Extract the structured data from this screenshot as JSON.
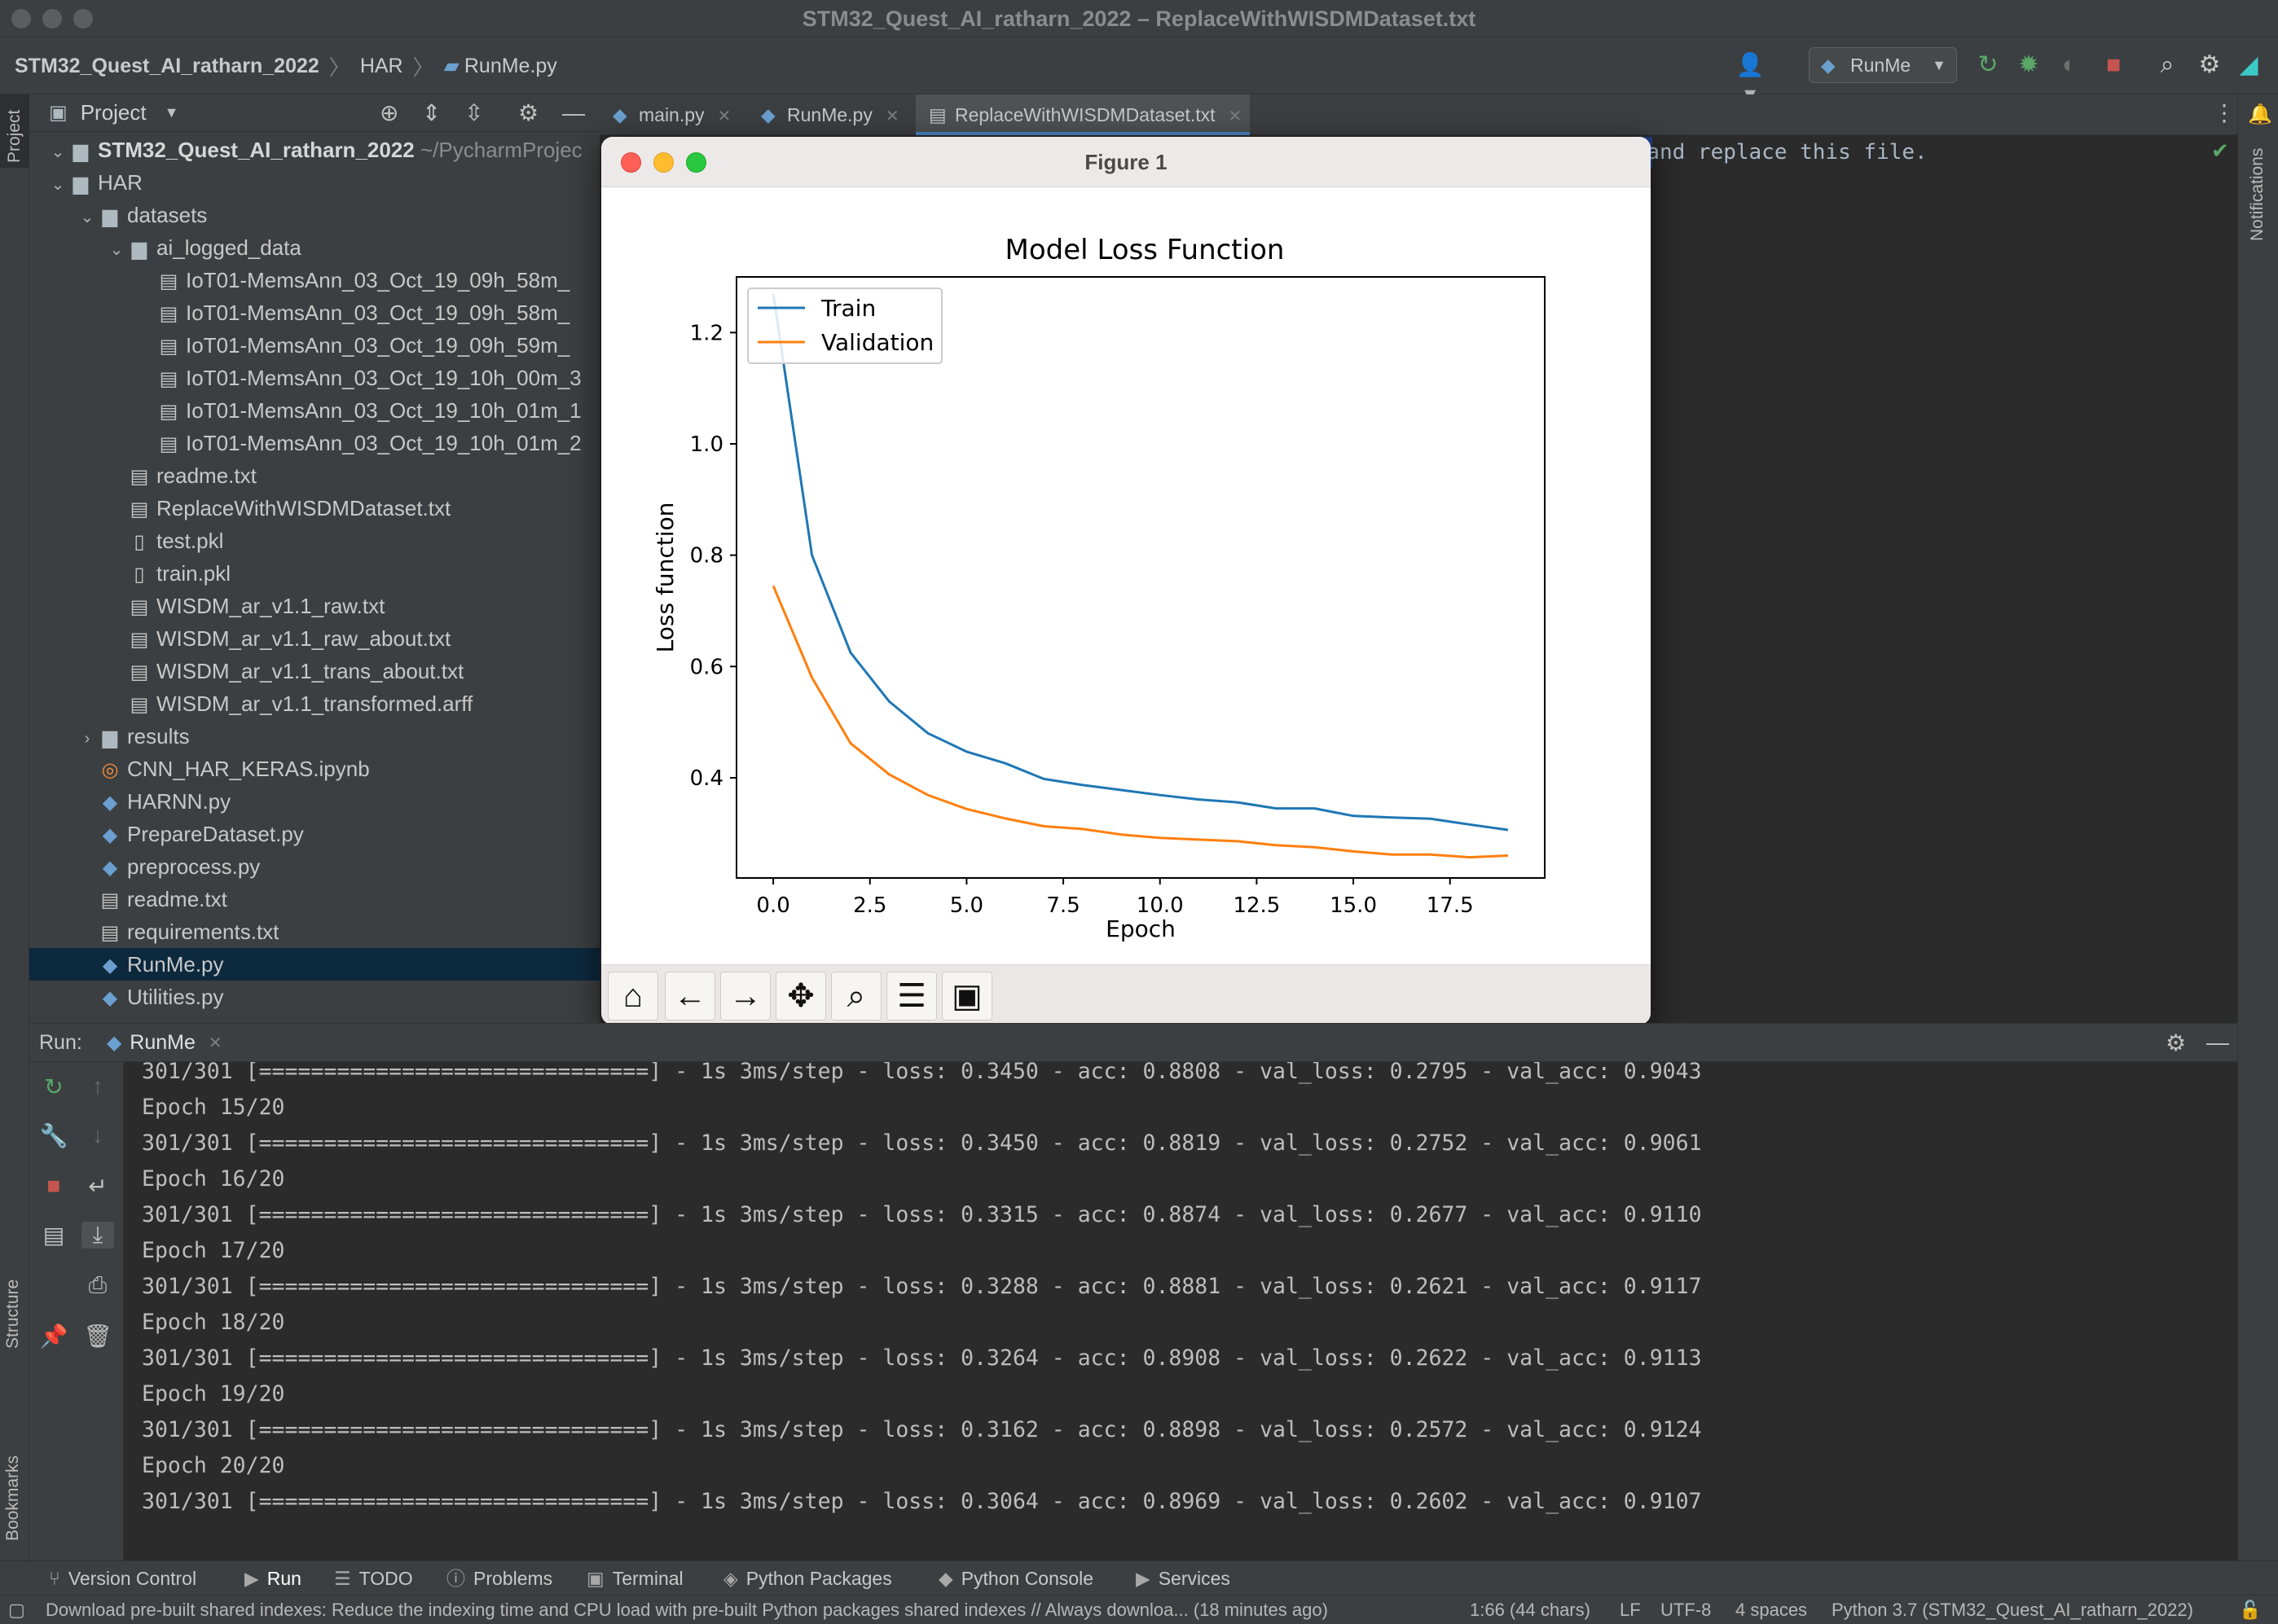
{
  "window": {
    "title": "STM32_Quest_AI_ratharn_2022 – ReplaceWithWISDMDataset.txt"
  },
  "breadcrumb": {
    "project": "STM32_Quest_AI_ratharn_2022",
    "folder": "HAR",
    "file": "RunMe.py"
  },
  "toolbar": {
    "run_config": "RunMe"
  },
  "project_panel": {
    "title": "Project",
    "root": {
      "name": "STM32_Quest_AI_ratharn_2022",
      "path": "~/PycharmProjec"
    },
    "items": [
      {
        "label": "HAR"
      },
      {
        "label": "datasets"
      },
      {
        "label": "ai_logged_data"
      },
      {
        "label": "IoT01-MemsAnn_03_Oct_19_09h_58m_"
      },
      {
        "label": "IoT01-MemsAnn_03_Oct_19_09h_58m_"
      },
      {
        "label": "IoT01-MemsAnn_03_Oct_19_09h_59m_"
      },
      {
        "label": "IoT01-MemsAnn_03_Oct_19_10h_00m_3"
      },
      {
        "label": "IoT01-MemsAnn_03_Oct_19_10h_01m_1"
      },
      {
        "label": "IoT01-MemsAnn_03_Oct_19_10h_01m_2"
      },
      {
        "label": "readme.txt"
      },
      {
        "label": "ReplaceWithWISDMDataset.txt"
      },
      {
        "label": "test.pkl"
      },
      {
        "label": "train.pkl"
      },
      {
        "label": "WISDM_ar_v1.1_raw.txt"
      },
      {
        "label": "WISDM_ar_v1.1_raw_about.txt"
      },
      {
        "label": "WISDM_ar_v1.1_trans_about.txt"
      },
      {
        "label": "WISDM_ar_v1.1_transformed.arff"
      },
      {
        "label": "results"
      },
      {
        "label": "CNN_HAR_KERAS.ipynb"
      },
      {
        "label": "HARNN.py"
      },
      {
        "label": "PrepareDataset.py"
      },
      {
        "label": "preprocess.py"
      },
      {
        "label": "readme.txt"
      },
      {
        "label": "requirements.txt"
      },
      {
        "label": "RunMe.py"
      },
      {
        "label": "Utilities.py"
      }
    ]
  },
  "left_strip": {
    "project": "Project",
    "structure": "Structure",
    "bookmarks": "Bookmarks"
  },
  "right_strip": {
    "notifications": "Notifications"
  },
  "editor": {
    "tabs": [
      {
        "label": "main.py"
      },
      {
        "label": "RunMe.py"
      },
      {
        "label": "ReplaceWithWISDMDataset.txt"
      }
    ],
    "visible_text": "p and replace this file."
  },
  "figure": {
    "window_title": "Figure 1"
  },
  "chart_data": {
    "type": "line",
    "title": "Model Loss Function",
    "xlabel": "Epoch",
    "ylabel": "Loss function",
    "xlim": [
      -0.95,
      19.95
    ],
    "ylim": [
      0.22,
      1.3
    ],
    "xticks": [
      "0.0",
      "2.5",
      "5.0",
      "7.5",
      "10.0",
      "12.5",
      "15.0",
      "17.5"
    ],
    "yticks": [
      "0.4",
      "0.6",
      "0.8",
      "1.0",
      "1.2"
    ],
    "legend_position": "top-left",
    "x": [
      0,
      1,
      2,
      3,
      4,
      5,
      6,
      7,
      8,
      9,
      10,
      11,
      12,
      13,
      14,
      15,
      16,
      17,
      18,
      19
    ],
    "series": [
      {
        "name": "Train",
        "color": "#1f77b4",
        "values": [
          1.27,
          0.8,
          0.625,
          0.537,
          0.48,
          0.447,
          0.426,
          0.398,
          0.387,
          0.378,
          0.369,
          0.361,
          0.356,
          0.345,
          0.345,
          0.3315,
          0.3288,
          0.3264,
          0.3162,
          0.3064
        ]
      },
      {
        "name": "Validation",
        "color": "#ff7f0e",
        "values": [
          0.745,
          0.58,
          0.462,
          0.406,
          0.369,
          0.344,
          0.327,
          0.313,
          0.308,
          0.298,
          0.292,
          0.289,
          0.286,
          0.279,
          0.2752,
          0.2677,
          0.2621,
          0.2622,
          0.2572,
          0.2602
        ]
      }
    ]
  },
  "run_panel": {
    "label": "Run:",
    "tab": "RunMe",
    "lines": [
      "301/301 [==============================] - 1s 3ms/step - loss: 0.3450 - acc: 0.8808 - val_loss: 0.2795 - val_acc: 0.9043",
      "Epoch 15/20",
      "301/301 [==============================] - 1s 3ms/step - loss: 0.3450 - acc: 0.8819 - val_loss: 0.2752 - val_acc: 0.9061",
      "Epoch 16/20",
      "301/301 [==============================] - 1s 3ms/step - loss: 0.3315 - acc: 0.8874 - val_loss: 0.2677 - val_acc: 0.9110",
      "Epoch 17/20",
      "301/301 [==============================] - 1s 3ms/step - loss: 0.3288 - acc: 0.8881 - val_loss: 0.2621 - val_acc: 0.9117",
      "Epoch 18/20",
      "301/301 [==============================] - 1s 3ms/step - loss: 0.3264 - acc: 0.8908 - val_loss: 0.2622 - val_acc: 0.9113",
      "Epoch 19/20",
      "301/301 [==============================] - 1s 3ms/step - loss: 0.3162 - acc: 0.8898 - val_loss: 0.2572 - val_acc: 0.9124",
      "Epoch 20/20",
      "301/301 [==============================] - 1s 3ms/step - loss: 0.3064 - acc: 0.8969 - val_loss: 0.2602 - val_acc: 0.9107"
    ]
  },
  "tool_windows": [
    {
      "label": "Version Control"
    },
    {
      "label": "Run"
    },
    {
      "label": "TODO"
    },
    {
      "label": "Problems"
    },
    {
      "label": "Terminal"
    },
    {
      "label": "Python Packages"
    },
    {
      "label": "Python Console"
    },
    {
      "label": "Services"
    }
  ],
  "status_bar": {
    "message": "Download pre-built shared indexes: Reduce the indexing time and CPU load with pre-built Python packages shared indexes // Always downloa... (18 minutes ago)",
    "position": "1:66 (44 chars)",
    "line_sep": "LF",
    "encoding": "UTF-8",
    "indent": "4 spaces",
    "interpreter": "Python 3.7 (STM32_Quest_AI_ratharn_2022)"
  }
}
